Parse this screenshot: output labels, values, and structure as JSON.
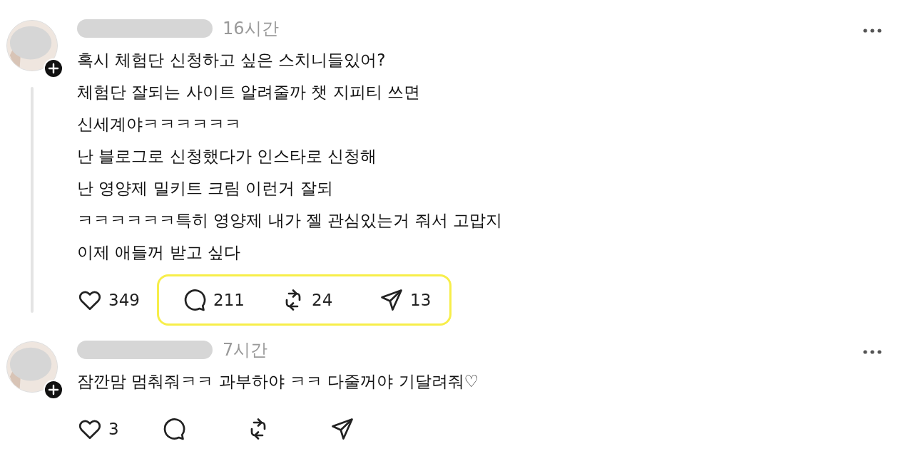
{
  "posts": [
    {
      "time": "16시간",
      "thread_line": true,
      "lines": [
        "혹시 체험단 신청하고 싶은 스치니들있어?",
        "체험단 잘되는 사이트 알려줄까 챗 지피티 쓰면",
        "신세계야ㅋㅋㅋㅋㅋㅋ",
        "난 블로그로 신청했다가 인스타로 신청해",
        "난 영양제 밀키트 크림 이런거 잘되",
        "ㅋㅋㅋㅋㅋㅋ특히 영양제 내가 젤 관심있는거 줘서 고맙지",
        "이제 애들꺼 받고 싶다"
      ],
      "highlighted_actions": true,
      "actions": [
        {
          "kind": "like",
          "count": "349"
        },
        {
          "kind": "reply",
          "count": "211"
        },
        {
          "kind": "repost",
          "count": "24"
        },
        {
          "kind": "share",
          "count": "13"
        }
      ]
    },
    {
      "time": "7시간",
      "thread_line": false,
      "lines": [
        "잠깐맘 멈춰줘ㅋㅋ 과부하야 ㅋㅋ 다줄꺼야 기달려줘♡"
      ],
      "highlighted_actions": false,
      "actions": [
        {
          "kind": "like",
          "count": "3"
        },
        {
          "kind": "reply"
        },
        {
          "kind": "repost"
        },
        {
          "kind": "share"
        }
      ]
    }
  ]
}
